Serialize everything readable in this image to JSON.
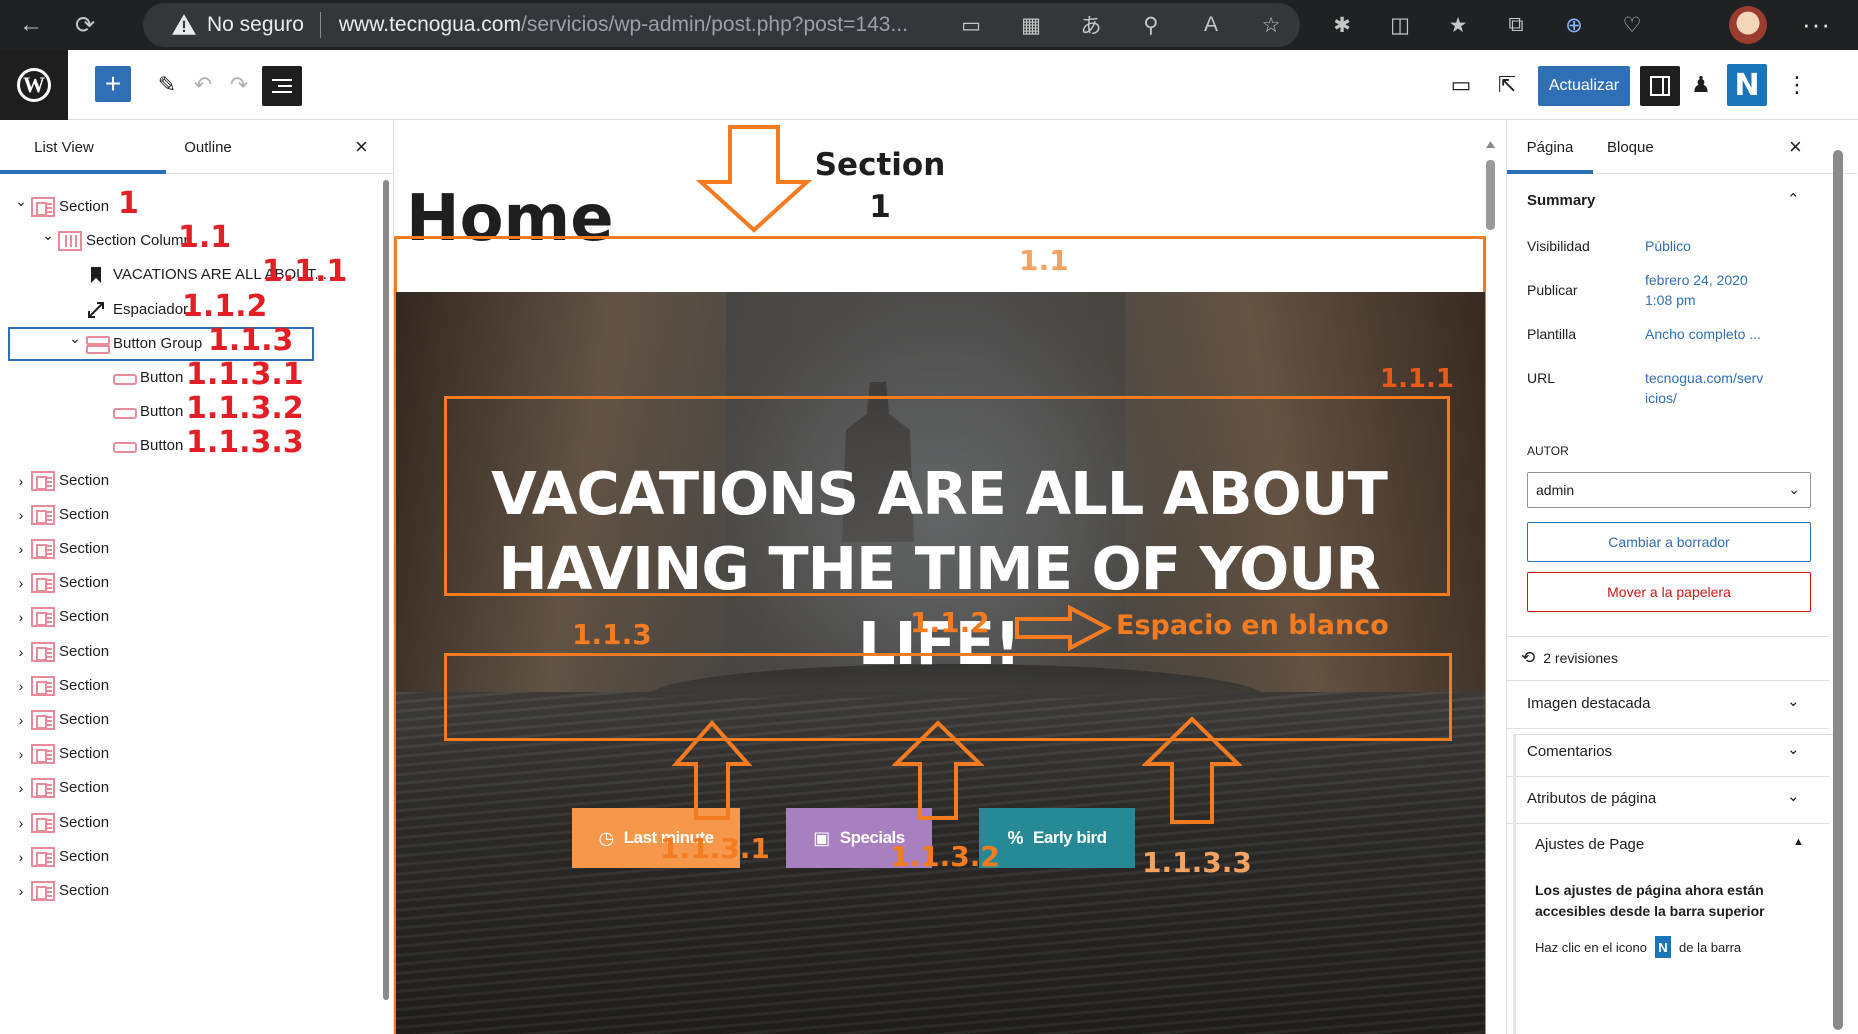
{
  "browser": {
    "insecure_label": "No seguro",
    "url_host": "www.tecnogua.com",
    "url_path": "/servicios/wp-admin/post.php?post=143..."
  },
  "toolbar": {
    "update_label": "Actualizar",
    "brand_letter": "N"
  },
  "list_view": {
    "tab_list": "List View",
    "tab_outline": "Outline",
    "rows": [
      {
        "label": "Section",
        "level": 0,
        "expanded": true,
        "icon": "section-icon",
        "ann": "1"
      },
      {
        "label": "Section Column",
        "level": 1,
        "expanded": true,
        "icon": "column-icon",
        "ann": "1.1"
      },
      {
        "label": "VACATIONS ARE ALL ABOUT...",
        "level": 2,
        "expanded": null,
        "icon": "heading-bookmark-icon",
        "ann": "1.1.1"
      },
      {
        "label": "Espaciador",
        "level": 2,
        "expanded": null,
        "icon": "spacer-resize-icon",
        "ann": "1.1.2"
      },
      {
        "label": "Button Group",
        "level": 2,
        "expanded": true,
        "icon": "button-group-icon",
        "ann": "1.1.3",
        "selected": true
      },
      {
        "label": "Button",
        "level": 3,
        "expanded": null,
        "icon": "button-icon",
        "ann": "1.1.3.1"
      },
      {
        "label": "Button",
        "level": 3,
        "expanded": null,
        "icon": "button-icon",
        "ann": "1.1.3.2"
      },
      {
        "label": "Button",
        "level": 3,
        "expanded": null,
        "icon": "button-icon",
        "ann": "1.1.3.3"
      },
      {
        "label": "Section",
        "level": 0,
        "expanded": false,
        "icon": "section-icon",
        "ann": ""
      },
      {
        "label": "Section",
        "level": 0,
        "expanded": false,
        "icon": "section-icon",
        "ann": ""
      },
      {
        "label": "Section",
        "level": 0,
        "expanded": false,
        "icon": "section-icon",
        "ann": ""
      },
      {
        "label": "Section",
        "level": 0,
        "expanded": false,
        "icon": "section-icon",
        "ann": ""
      },
      {
        "label": "Section",
        "level": 0,
        "expanded": false,
        "icon": "section-icon",
        "ann": ""
      },
      {
        "label": "Section",
        "level": 0,
        "expanded": false,
        "icon": "section-icon",
        "ann": ""
      },
      {
        "label": "Section",
        "level": 0,
        "expanded": false,
        "icon": "section-icon",
        "ann": ""
      },
      {
        "label": "Section",
        "level": 0,
        "expanded": false,
        "icon": "section-icon",
        "ann": ""
      },
      {
        "label": "Section",
        "level": 0,
        "expanded": false,
        "icon": "section-icon",
        "ann": ""
      },
      {
        "label": "Section",
        "level": 0,
        "expanded": false,
        "icon": "section-icon",
        "ann": ""
      },
      {
        "label": "Section",
        "level": 0,
        "expanded": false,
        "icon": "section-icon",
        "ann": ""
      },
      {
        "label": "Section",
        "level": 0,
        "expanded": false,
        "icon": "section-icon",
        "ann": ""
      },
      {
        "label": "Section",
        "level": 0,
        "expanded": false,
        "icon": "section-icon",
        "ann": ""
      }
    ]
  },
  "canvas": {
    "page_title": "Home",
    "hero_heading": "VACATIONS ARE ALL ABOUT HAVING THE TIME OF YOUR LIFE!",
    "buttons": [
      {
        "label": "Last minute",
        "icon": "clock-icon",
        "color": "#f5984b"
      },
      {
        "label": "Specials",
        "icon": "gift-icon",
        "color": "#a87fbf"
      },
      {
        "label": "Early bird",
        "icon": "percent-icon",
        "color": "#268a96"
      }
    ],
    "annotations": {
      "section_line1": "Section",
      "section_line2": "1",
      "column": "1.1",
      "heading": "1.1.1",
      "spacer": "1.1.2",
      "spacer_label": "Espacio en blanco",
      "group": "1.1.3",
      "btn1": "1.1.3.1",
      "btn2": "1.1.3.2",
      "btn3": "1.1.3.3"
    },
    "annotation_color": "#f47b20"
  },
  "sidebar": {
    "tab_page": "Página",
    "tab_block": "Bloque",
    "summary_heading": "Summary",
    "visibility_label": "Visibilidad",
    "visibility_value": "Público",
    "publish_label": "Publicar",
    "publish_value_line1": "febrero 24, 2020",
    "publish_value_line2": "1:08 pm",
    "template_label": "Plantilla",
    "template_value": "Ancho completo ...",
    "url_label": "URL",
    "url_value_line1": "tecnogua.com/serv",
    "url_value_line2": "icios/",
    "author_label": "AUTOR",
    "author_value": "admin",
    "draft_button": "Cambiar a borrador",
    "trash_button": "Mover a la papelera",
    "revisions": "2 revisiones",
    "featured_image": "Imagen destacada",
    "comments": "Comentarios",
    "page_attributes": "Atributos de página",
    "page_settings": "Ajustes de Page",
    "notice_bold": "Los ajustes de página ahora están accesibles desde la barra superior",
    "notice_pre": "Haz clic en el icono",
    "notice_post": "de la barra"
  }
}
